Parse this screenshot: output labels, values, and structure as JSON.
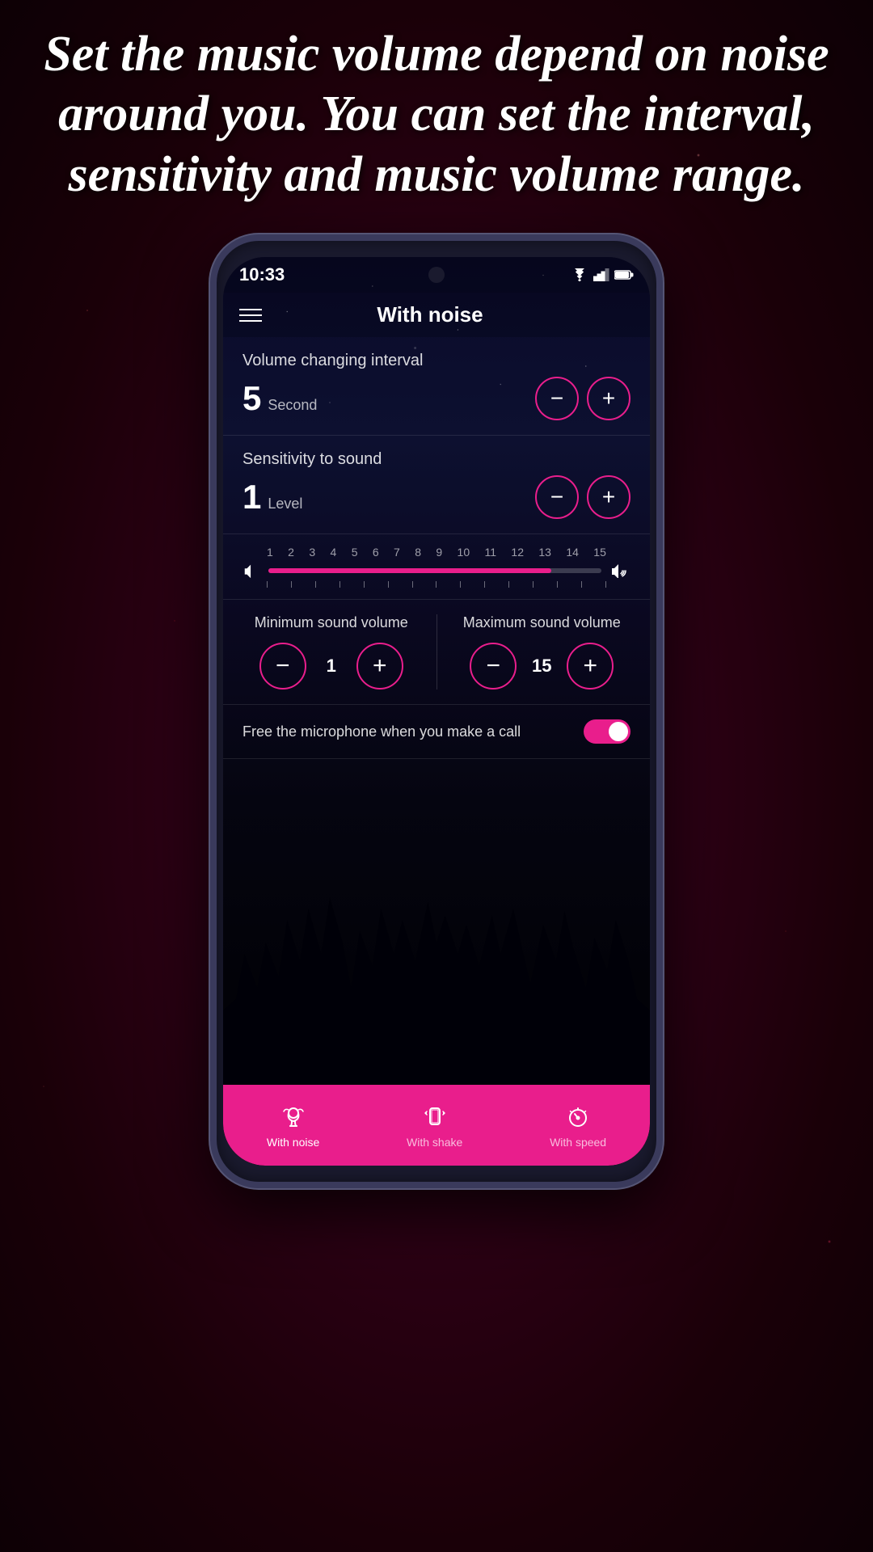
{
  "background": {
    "color": "#3a0020"
  },
  "header_text": "Set the music volume depend on noise around you. You can set the interval, sensitivity and music volume range.",
  "phone": {
    "status_bar": {
      "time": "10:33",
      "icons": [
        "wifi",
        "signal",
        "battery"
      ]
    },
    "app": {
      "title": "With noise",
      "volume_interval": {
        "label": "Volume changing interval",
        "value": "5",
        "unit": "Second"
      },
      "sensitivity": {
        "label": "Sensitivity to sound",
        "value": "1",
        "unit": "Level"
      },
      "slider": {
        "numbers": [
          "1",
          "2",
          "3",
          "4",
          "5",
          "6",
          "7",
          "8",
          "9",
          "10",
          "11",
          "12",
          "13",
          "14",
          "15"
        ],
        "fill_percent": 85
      },
      "min_volume": {
        "label": "Minimum sound volume",
        "value": "1"
      },
      "max_volume": {
        "label": "Maximum sound volume",
        "value": "15"
      },
      "microphone_toggle": {
        "label": "Free the microphone when you make a call",
        "enabled": true
      }
    },
    "bottom_nav": {
      "items": [
        {
          "id": "with-noise",
          "label": "With noise",
          "active": true
        },
        {
          "id": "with-shake",
          "label": "With shake",
          "active": false
        },
        {
          "id": "with-speed",
          "label": "With speed",
          "active": false
        }
      ]
    }
  },
  "colors": {
    "accent": "#e91e8c",
    "background_dark": "#0a0a1a",
    "text_primary": "#ffffff",
    "text_secondary": "rgba(255,255,255,0.7)"
  }
}
